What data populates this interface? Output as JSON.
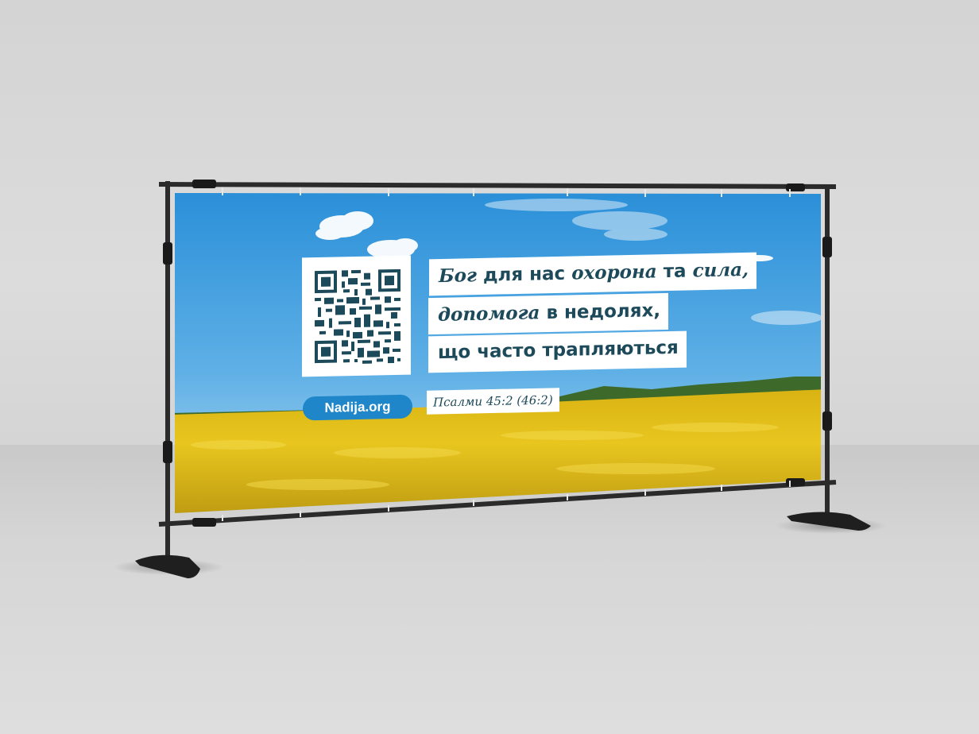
{
  "banner": {
    "verse_line1_italic1": "Бог",
    "verse_line1_plain1": " для нас ",
    "verse_line1_italic2": "охорона",
    "verse_line1_plain2": " та ",
    "verse_line1_italic3": "сила,",
    "verse_line2_italic": "допомога",
    "verse_line2_plain": " в недолях,",
    "verse_line3": "що часто трапляються",
    "reference": "Псалми 45:2 (46:2)",
    "website": "Nadija.org"
  },
  "colors": {
    "sky_top": "#2a8fd8",
    "sky_bottom": "#a9d4ee",
    "field": "#e3c21a",
    "text_dark": "#1d4a5a",
    "pill_blue": "#1f86c9",
    "frame": "#2b2b2b"
  },
  "icons": [
    "qr-code-icon"
  ]
}
